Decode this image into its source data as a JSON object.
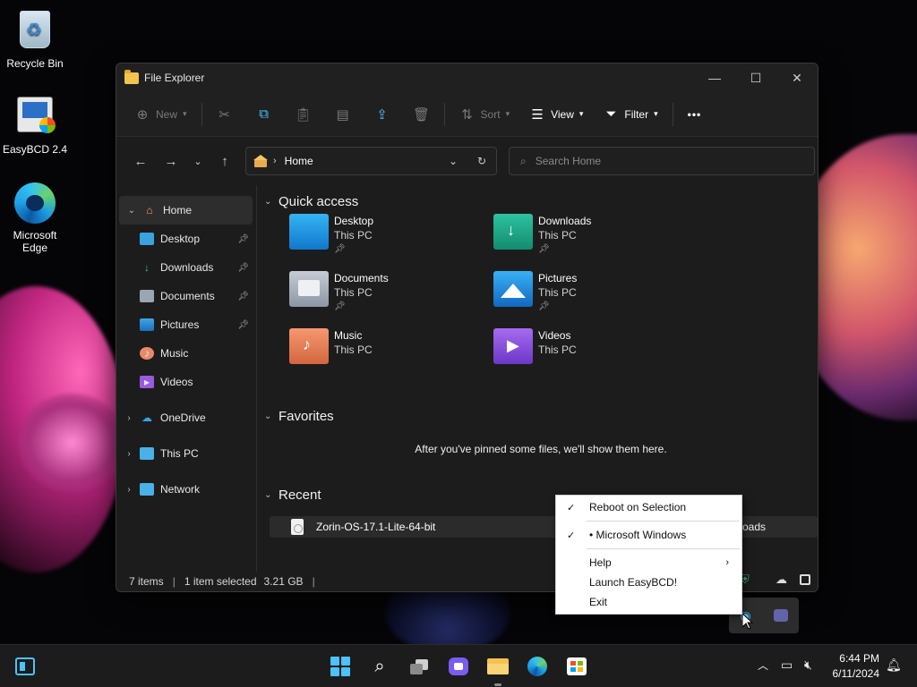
{
  "desktop": {
    "icons": [
      {
        "label": "Recycle Bin"
      },
      {
        "label": "EasyBCD 2.4"
      },
      {
        "label": "Microsoft Edge"
      }
    ]
  },
  "window": {
    "title": "File Explorer",
    "controls": {
      "minimize": "—",
      "maximize": "☐",
      "close": "✕"
    }
  },
  "toolbar": {
    "new_label": "New",
    "sort_label": "Sort",
    "view_label": "View",
    "filter_label": "Filter",
    "more_label": "•••"
  },
  "address": {
    "path_label": "Home",
    "search_placeholder": "Search Home"
  },
  "nav": {
    "home": "Home",
    "items": [
      {
        "label": "Desktop"
      },
      {
        "label": "Downloads"
      },
      {
        "label": "Documents"
      },
      {
        "label": "Pictures"
      },
      {
        "label": "Music"
      },
      {
        "label": "Videos"
      }
    ],
    "onedrive": "OneDrive",
    "thispc": "This PC",
    "network": "Network"
  },
  "content": {
    "quick_access_title": "Quick access",
    "quick_access": [
      {
        "name": "Desktop",
        "location": "This PC",
        "pinned": true
      },
      {
        "name": "Downloads",
        "location": "This PC",
        "pinned": true
      },
      {
        "name": "Documents",
        "location": "This PC",
        "pinned": true
      },
      {
        "name": "Pictures",
        "location": "This PC",
        "pinned": true
      },
      {
        "name": "Music",
        "location": "This PC",
        "pinned": false
      },
      {
        "name": "Videos",
        "location": "This PC",
        "pinned": false
      }
    ],
    "favorites_title": "Favorites",
    "favorites_empty": "After you've pinned some files, we'll show them here.",
    "recent_title": "Recent",
    "recent_file": "Zorin-OS-17.1-Lite-64-bit",
    "recent_tail": "oads"
  },
  "status": {
    "items": "7 items",
    "selected": "1 item selected",
    "size": "3.21 GB"
  },
  "context_menu": {
    "reboot": "Reboot on Selection",
    "windows_entry": "• Microsoft Windows",
    "help": "Help",
    "launch": "Launch EasyBCD!",
    "exit": "Exit"
  },
  "taskbar": {
    "time": "6:44 PM",
    "date": "6/11/2024"
  },
  "colors": {
    "accent": "#4cc2ff",
    "window_bg": "#1c1c1c",
    "menu_bg": "#ffffff"
  }
}
